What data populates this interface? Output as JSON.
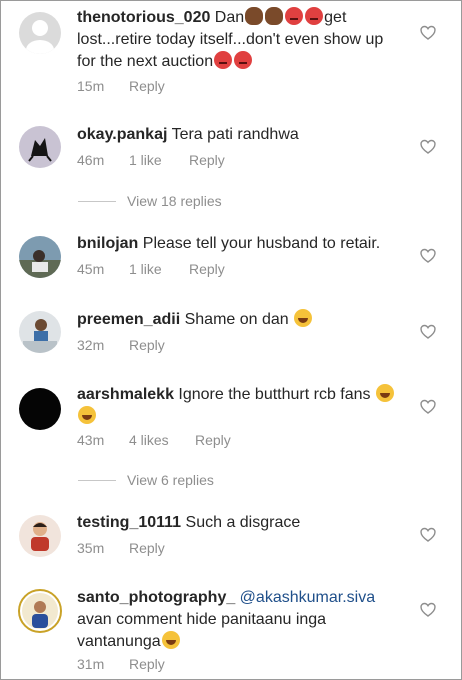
{
  "comments": [
    {
      "username": "thenotorious_020",
      "text1": " Dan",
      "text2": "get",
      "line2": "lost...retire today itself...don't even show up",
      "line3": "for the next auction",
      "time": "15m",
      "reply": "Reply",
      "avatar_icon": "default-avatar-icon"
    },
    {
      "username": "okay.pankaj",
      "text": " Tera pati randhwa",
      "time": "46m",
      "likes": "1 like",
      "reply": "Reply",
      "avatar_icon": "photo-avatar"
    },
    {
      "username": "bnilojan",
      "text": " Please tell your husband to retair.",
      "time": "45m",
      "likes": "1 like",
      "reply": "Reply"
    },
    {
      "username": "preemen_adii",
      "text": " Shame on dan ",
      "time": "32m",
      "reply": "Reply"
    },
    {
      "username": "aarshmalekk",
      "text": " Ignore the butthurt rcb fans ",
      "time": "43m",
      "likes": "4 likes",
      "reply": "Reply"
    },
    {
      "username": "testing_10111",
      "text": " Such a disgrace",
      "time": "35m",
      "reply": "Reply"
    },
    {
      "username": "santo_photography_",
      "mention": " @akashkumar.siva",
      "line2": "avan comment hide panitaanu inga",
      "line3": "vantanunga",
      "time": "31m",
      "reply": "Reply"
    }
  ],
  "view_replies": [
    {
      "label": "View 18 replies"
    },
    {
      "label": "View 6 replies"
    }
  ],
  "colors": {
    "text": "#262626",
    "meta": "#8e8e8e",
    "mention": "#1f4f8a"
  }
}
